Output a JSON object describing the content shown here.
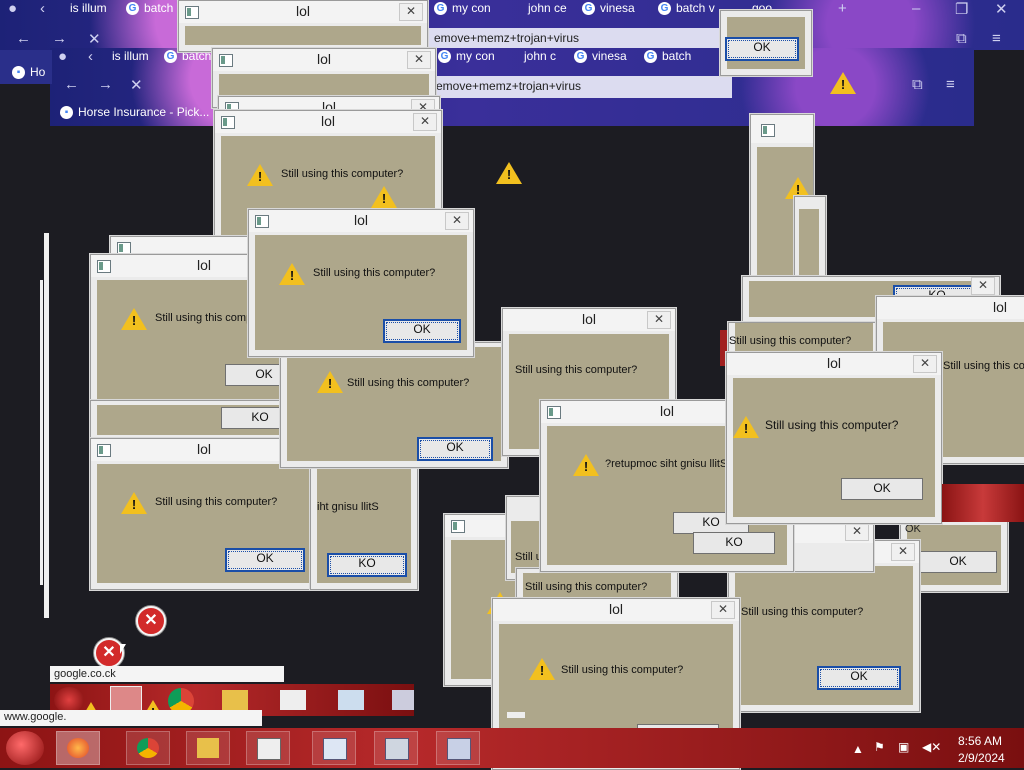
{
  "browser_top": {
    "tabs": [
      "is illum",
      "batch",
      "my con",
      "john ce",
      "vinesa",
      "batch v",
      "goo"
    ],
    "url": "emove+memz+trojan+virus"
  },
  "browser_second": {
    "tabs": [
      "is illum",
      "batch",
      "my con",
      "john c",
      "vinesa",
      "batch"
    ],
    "url": "emove+memz+trojan+virus",
    "page_tab": "Horse Insurance - Pick..."
  },
  "browser_third": {
    "tab": "Ho"
  },
  "dialog": {
    "title": "lol",
    "message": "Still using this computer?",
    "message_reversed": "?retupmoc siht gnisu llitS",
    "message_partial": "iht gnisu llitS",
    "message_cut": "Still using this comp",
    "ok_label": "OK",
    "ok_flipped": "KO",
    "close_glyph": "✕"
  },
  "status": {
    "link_preview": "google.co.ck",
    "status_url": "www.google."
  },
  "clock": {
    "time": "8:56 AM",
    "date": "2/9/2024"
  },
  "icons": {
    "warning": "warning-icon",
    "error": "error-icon"
  },
  "colors": {
    "dialog_body": "#aea78b",
    "taskbar": "#b6292a",
    "warning": "#f2c01f"
  }
}
